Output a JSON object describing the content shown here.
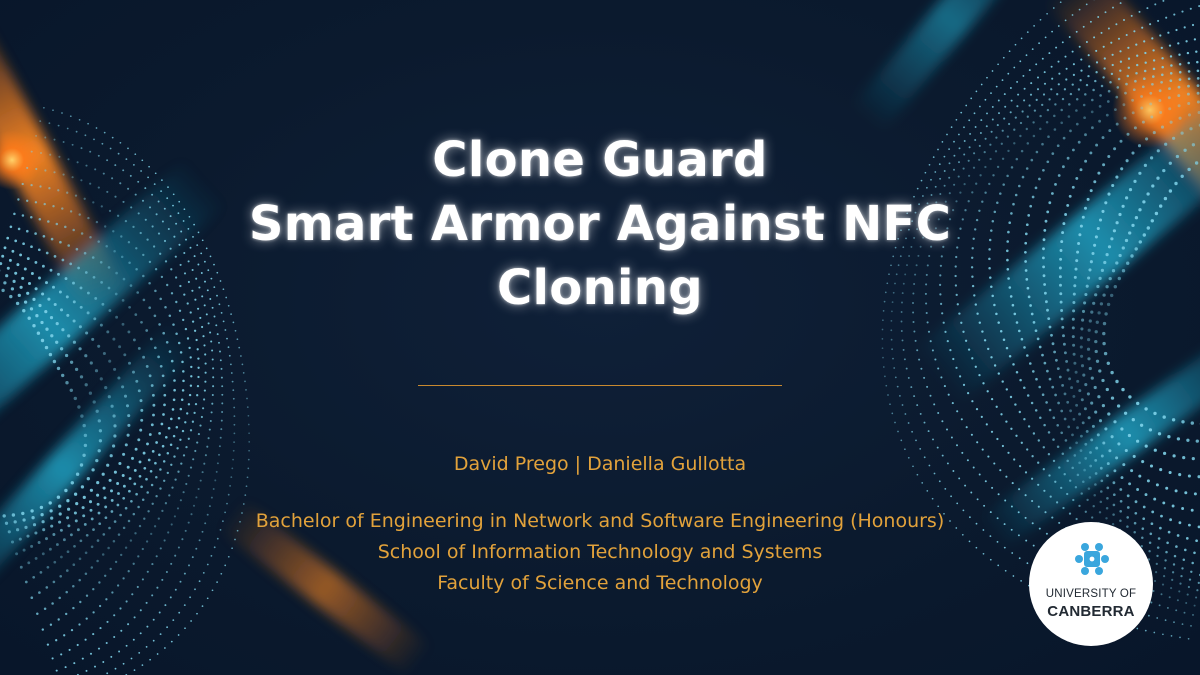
{
  "slide": {
    "title_lines": [
      "Clone Guard",
      "Smart Armor Against NFC",
      "Cloning"
    ],
    "authors": "David Prego | Daniella Gullotta",
    "affiliation_lines": [
      "Bachelor of Engineering in Network and Software Engineering (Honours)",
      "School of Information Technology and Systems",
      "Faculty of Science and Technology"
    ]
  },
  "logo": {
    "icon": "university-logo-icon",
    "line1": "UNIVERSITY OF",
    "line2": "CANBERRA"
  },
  "colors": {
    "background": "#0b1a2e",
    "title": "#ffffff",
    "accent_text": "#e2a23b",
    "divider": "#c8892f",
    "dots": "#7fd3ea",
    "streak_orange": "#ff7a1a",
    "streak_teal": "#1aa3c8"
  }
}
